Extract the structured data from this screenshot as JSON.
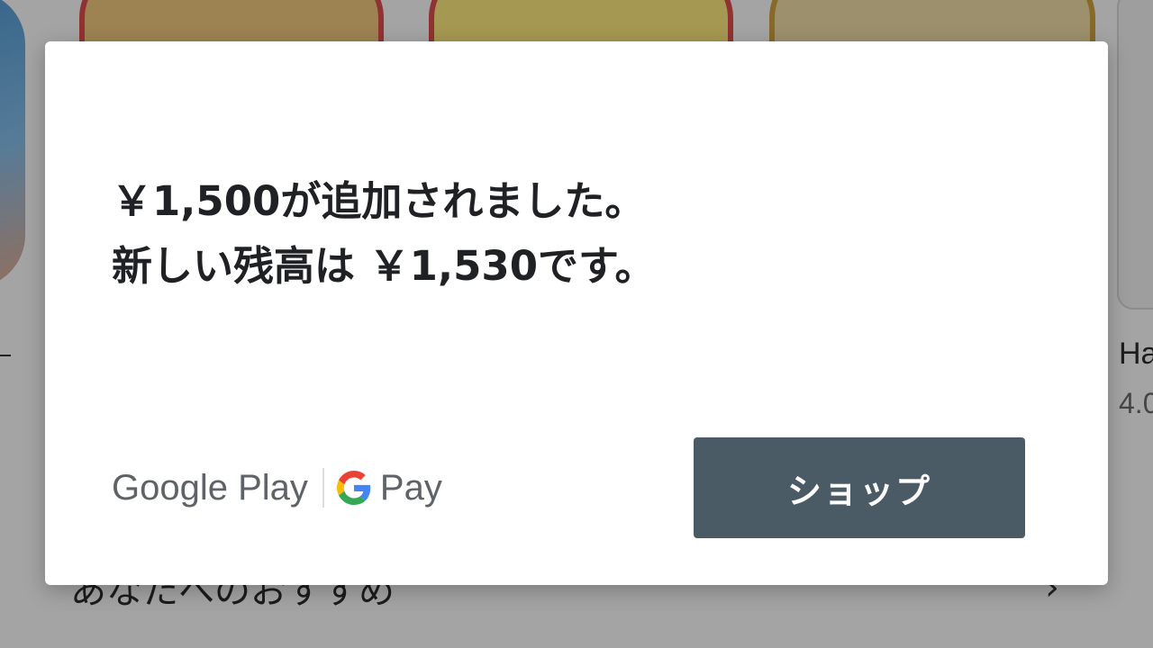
{
  "dialog": {
    "message_line1": "￥1,500が追加されました。",
    "message_line2": "新しい残高は ￥1,530です。",
    "brand_google_play": "Google Play",
    "brand_pay": "Pay",
    "shop_button_label": "ショップ",
    "button_color": "#4a5b66"
  },
  "background": {
    "partial_app_title": "Ha",
    "partial_rating": "4.0",
    "section_header_partial": "あなたへのおすすめ",
    "arrow": "›"
  },
  "icons": [
    "google-g-icon",
    "chevron-right-icon"
  ]
}
